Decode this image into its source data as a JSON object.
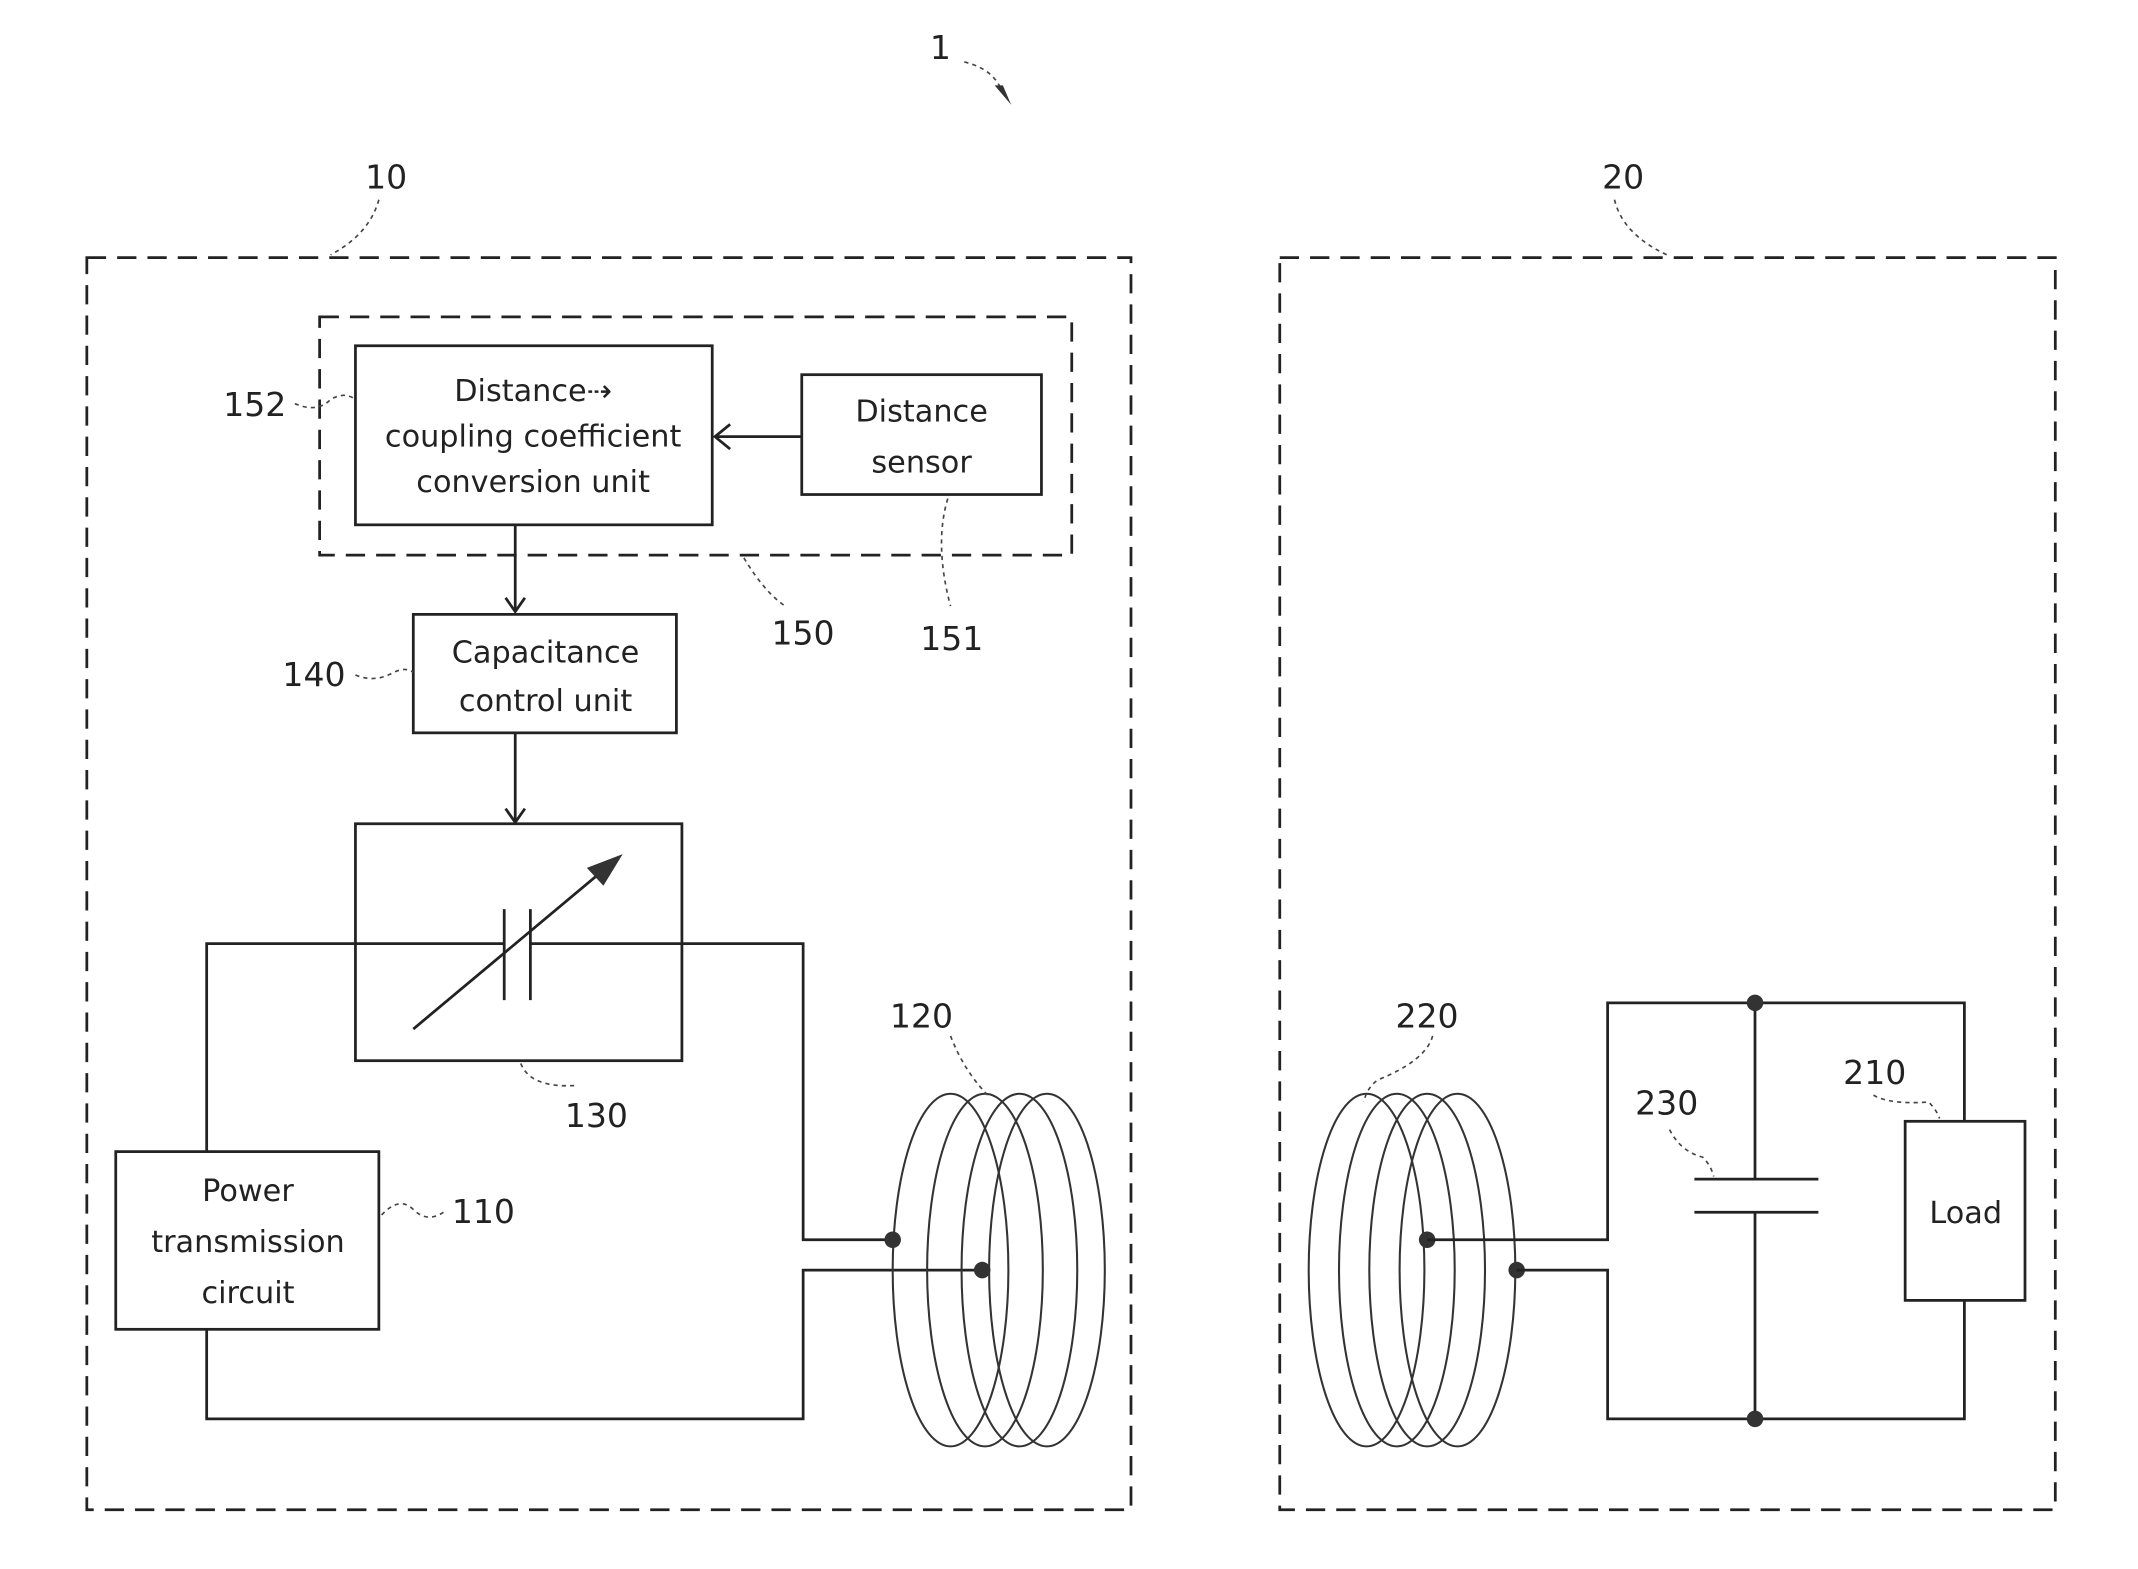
{
  "figure": {
    "system_ref": "1",
    "transmitter": {
      "ref": "10",
      "distance_unit": {
        "ref": "150",
        "conversion_unit": {
          "ref": "152",
          "lines": [
            "Distance⇢",
            "coupling coefficient",
            "conversion unit"
          ]
        },
        "distance_sensor": {
          "ref": "151",
          "lines": [
            "Distance",
            "sensor"
          ]
        }
      },
      "capacitance_control": {
        "ref": "140",
        "lines": [
          "Capacitance",
          "control unit"
        ]
      },
      "variable_capacitor": {
        "ref": "130"
      },
      "power_circuit": {
        "ref": "110",
        "lines": [
          "Power",
          "transmission",
          "circuit"
        ]
      },
      "coil": {
        "ref": "120"
      }
    },
    "receiver": {
      "ref": "20",
      "coil": {
        "ref": "220"
      },
      "capacitor": {
        "ref": "230"
      },
      "load": {
        "ref": "210",
        "label": "Load"
      }
    }
  }
}
